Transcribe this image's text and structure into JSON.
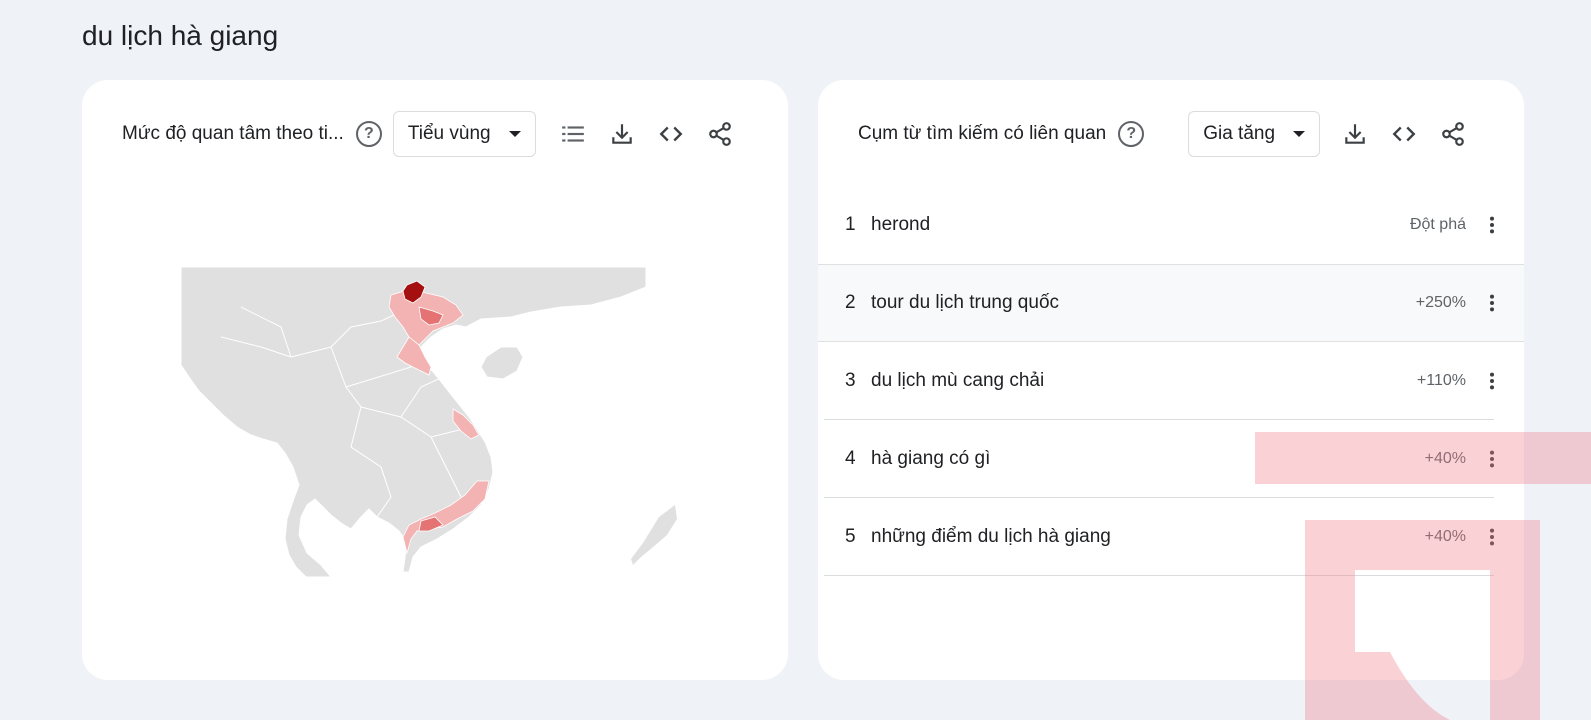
{
  "page": {
    "title": "du lịch hà giang"
  },
  "interest_card": {
    "title": "Mức độ quan tâm theo ti...",
    "region_select": {
      "selected": "Tiểu vùng"
    },
    "icons": [
      "help-icon",
      "list-icon",
      "download-icon",
      "embed-icon",
      "share-icon"
    ],
    "map": {
      "highest_color": "#a50f0f",
      "high_color": "#e57373",
      "medium_color": "#f4b3b3",
      "no_data_color": "#e0e0e0"
    }
  },
  "related_card": {
    "title": "Cụm từ tìm kiếm có liên quan",
    "sort_select": {
      "selected": "Gia tăng"
    },
    "icons": [
      "help-icon",
      "download-icon",
      "embed-icon",
      "share-icon"
    ],
    "rows": [
      {
        "rank": "1",
        "term": "herond",
        "value": "Đột phá"
      },
      {
        "rank": "2",
        "term": "tour du lịch trung quốc",
        "value": "+250%"
      },
      {
        "rank": "3",
        "term": "du lịch mù cang chải",
        "value": "+110%"
      },
      {
        "rank": "4",
        "term": "hà giang có gì",
        "value": "+40%"
      },
      {
        "rank": "5",
        "term": "những điểm du lịch hà giang",
        "value": "+40%"
      }
    ]
  }
}
